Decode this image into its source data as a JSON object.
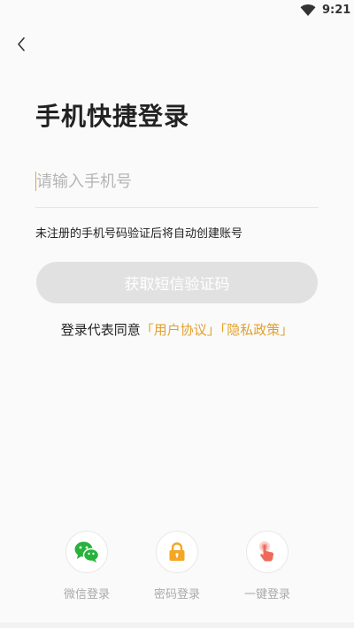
{
  "status_bar": {
    "time": "9:21"
  },
  "header": {
    "title": "手机快捷登录"
  },
  "phone": {
    "placeholder": "请输入手机号",
    "value": ""
  },
  "hint": "未注册的手机号码验证后将自动创建账号",
  "sms_button_label": "获取短信验证码",
  "agreement": {
    "prefix": "登录代表同意",
    "user_agreement": "「用户协议」",
    "privacy_policy": "「隐私政策」"
  },
  "login_options": [
    {
      "label": "微信登录",
      "icon": "wechat-icon"
    },
    {
      "label": "密码登录",
      "icon": "lock-icon"
    },
    {
      "label": "一键登录",
      "icon": "tap-hand-icon"
    }
  ],
  "colors": {
    "accent": "#e2a12c",
    "button_disabled": "#e1e1e1",
    "wechat": "#27b23c",
    "lock": "#f5a623",
    "tap": "#f06a5b"
  }
}
